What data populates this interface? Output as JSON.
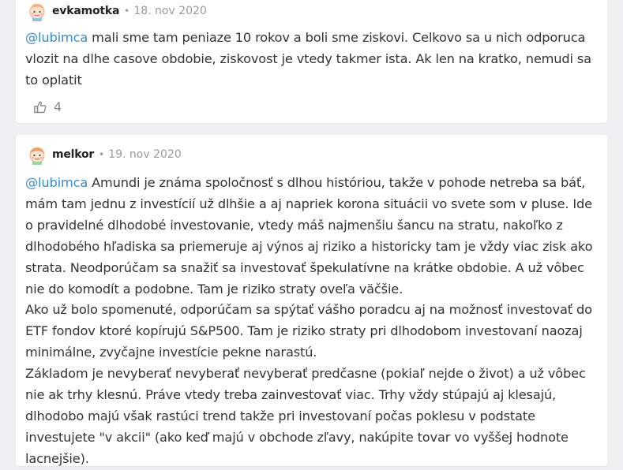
{
  "comments": [
    {
      "author": "evkamotka",
      "separator": "•",
      "date": "18. nov 2020",
      "mention": "@lubimca",
      "text": "mali sme tam peniaze 10 rokov a boli sme ziskovi. Celkovo sa u nich odporuca vlozit na dlhe casove obdobie, ziskovost je vtedy takmer ista. Ak len na kratko, nemudi sa to oplatit",
      "likes": "4",
      "icons": [
        "avatar-icon",
        "thumbs-up-icon"
      ]
    },
    {
      "author": "melkor",
      "separator": "•",
      "date": "19. nov 2020",
      "mention": "@lubimca",
      "paragraphs": [
        "Amundi je známa spoločnosť s dlhou históriou, takže v pohode netreba sa báť, mám tam jednu z investícií už dlhšie a aj napriek korona situácii vo svete som v pluse. Ide o pravidelné dlhodobé investovanie, vtedy máš najmenšiu šancu na stratu, nakoľko z dlhodobého hľadiska sa priemeruje aj výnos aj riziko a historicky tam je vždy viac zisk ako strata. Neodporúčam sa snažiť sa investovať špekulatívne na krátke obdobie. A už vôbec nie do komodít a podobne. Tam je riziko straty oveľa väčšie.",
        "Ako už bolo spomenuté, odporúčam sa spýtať vášho poradcu aj na možnosť investovať do ETF fondov ktoré kopírujú S&P500. Tam je riziko straty pri dlhodobom investovaní naozaj minimálne, zvyčajne investície pekne narastú.",
        "Základom je nevyberať nevyberať nevyberať predčasne (pokiaľ nejde o život) a už vôbec nie ak trhy klesnú. Práve vtedy treba zainvestovať viac. Trhy vždy stúpajú aj klesajú, dlhodobo majú však rastúci trend takže pri investovaní počas poklesu v podstate investujete \"v akcii\" (ako keď majú v obchode zľavy, nakúpite tovar vo vyššej hodnote lacnejšie)."
      ],
      "icons": [
        "avatar-icon"
      ]
    }
  ],
  "colors": {
    "mention": "#3d8ac9",
    "background": "#f0f0f2",
    "card": "#ffffff"
  }
}
